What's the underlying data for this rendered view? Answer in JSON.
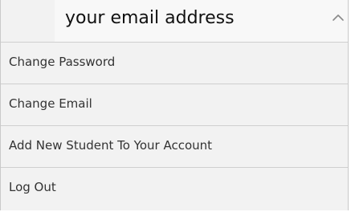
{
  "account_menu": {
    "email_value": "your email address",
    "toggle_icon": "chevron-up-icon",
    "items": [
      {
        "label": "Change Password"
      },
      {
        "label": "Change Email"
      },
      {
        "label": "Add New Student To Your Account"
      },
      {
        "label": "Log Out"
      }
    ]
  }
}
